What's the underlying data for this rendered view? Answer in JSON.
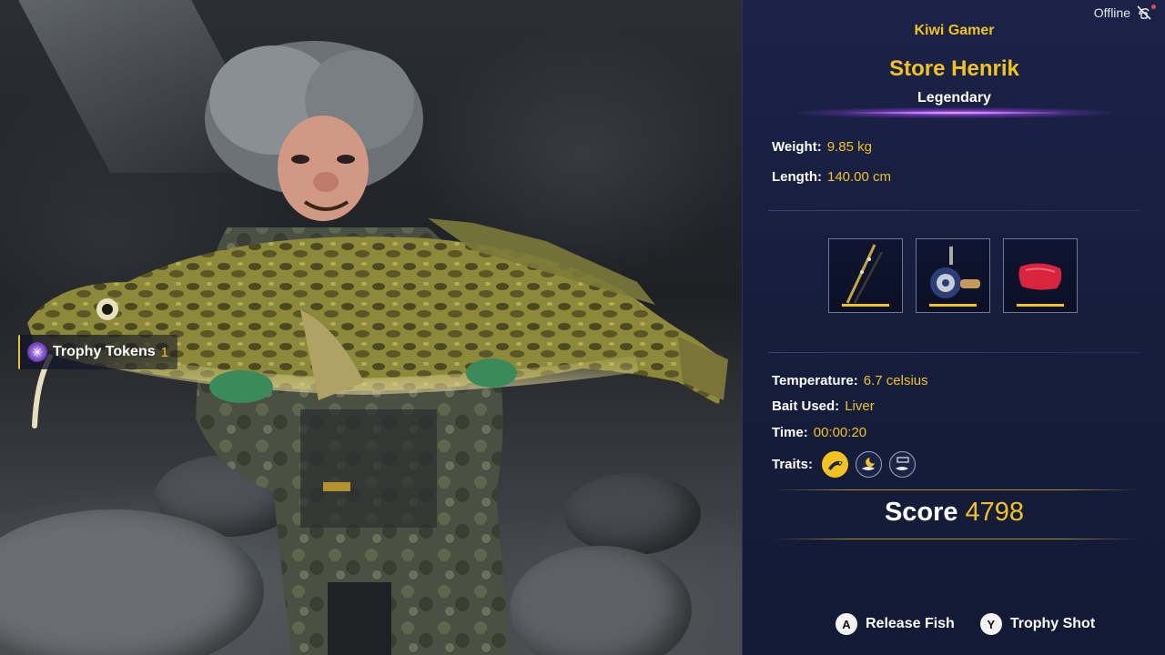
{
  "status": {
    "label": "Offline",
    "icon": "offline-icon"
  },
  "trophy_tokens": {
    "label": "Trophy Tokens",
    "count": "1",
    "icon": "trophy-token-icon"
  },
  "catch": {
    "player": "Kiwi Gamer",
    "fish_name": "Store Henrik",
    "rarity": "Legendary",
    "weight_label": "Weight:",
    "weight_value": "9.85 kg",
    "length_label": "Length:",
    "length_value": "140.00 cm",
    "temperature_label": "Temperature:",
    "temperature_value": "6.7 celsius",
    "bait_label": "Bait Used:",
    "bait_value": "Liver",
    "time_label": "Time:",
    "time_value": "00:00:20",
    "traits_label": "Traits:",
    "traits": [
      "predator-trait-icon",
      "night-feeder-trait-icon",
      "bottom-dweller-trait-icon"
    ],
    "score_label": "Score",
    "score_value": "4798"
  },
  "gear": [
    {
      "icon": "fishing-rod-icon"
    },
    {
      "icon": "spinning-reel-icon"
    },
    {
      "icon": "bait-liver-icon"
    }
  ],
  "prompts": [
    {
      "button": "A",
      "label": "Release Fish"
    },
    {
      "button": "Y",
      "label": "Trophy Shot"
    }
  ],
  "colors": {
    "accent": "#f2c21e",
    "panel": "#1a2347",
    "legendary": "#c070ff"
  }
}
